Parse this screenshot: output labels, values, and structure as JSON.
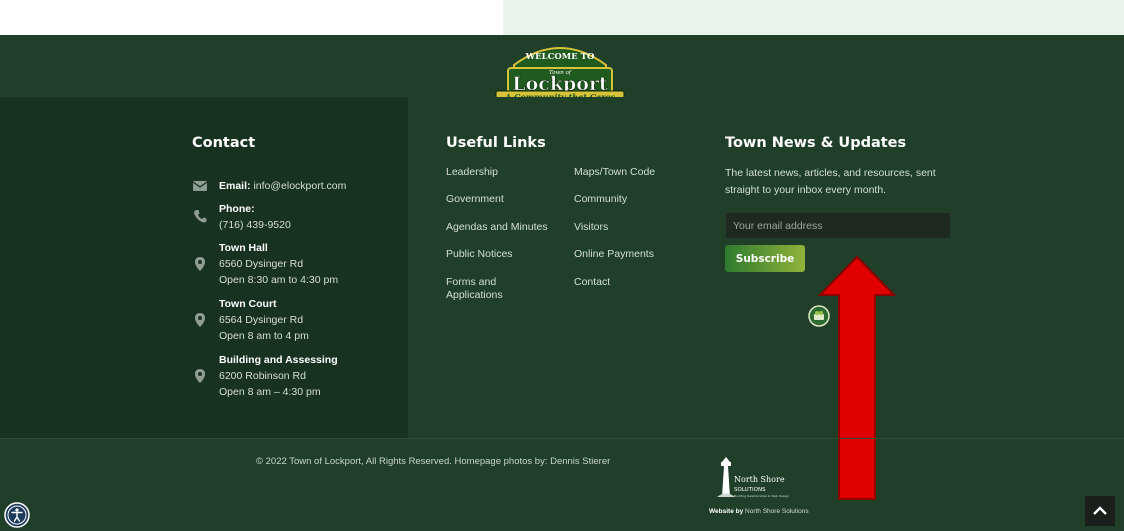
{
  "logo": {
    "welcome": "WELCOME TO",
    "town_of": "Town of",
    "name": "Lockport",
    "tagline": "A Community that Cares",
    "established": "ESTABLISHED 1824"
  },
  "contact": {
    "title": "Contact",
    "email_label": "Email:",
    "email_value": "info@elockport.com",
    "phone_label": "Phone:",
    "phone_value": "(716) 439-9520",
    "locations": [
      {
        "name": "Town Hall",
        "address": "6560 Dysinger Rd",
        "hours": "Open 8:30 am to 4:30 pm"
      },
      {
        "name": "Town Court",
        "address": "6564 Dysinger Rd",
        "hours": "Open 8 am to 4 pm"
      },
      {
        "name": "Building and Assessing",
        "address": "6200 Robinson Rd",
        "hours": "Open 8 am – 4:30 pm"
      }
    ]
  },
  "useful_links": {
    "title": "Useful Links",
    "col1": [
      "Leadership",
      "Government",
      "Agendas and Minutes",
      "Public Notices",
      "Forms and",
      "Applications"
    ],
    "col2": [
      "Maps/Town Code",
      "Community",
      "Visitors",
      "Online Payments",
      "Contact"
    ]
  },
  "news": {
    "title": "Town News & Updates",
    "description": "The latest news, articles, and resources, sent straight to your inbox every month.",
    "email_placeholder": "Your email address",
    "subscribe_label": "Subscribe"
  },
  "footer": {
    "copyright": "© 2022 Town of Lockport, All Rights Reserved. Homepage photos by: Dennis Stierer",
    "nss_name_1": "North Shore",
    "nss_name_2": "SOLUTIONS",
    "nss_tagline": "Building Relationships & Web Design",
    "credit_prefix": "Website by",
    "credit_name": "North Shore Solutions"
  },
  "icons": {
    "email": "envelope-icon",
    "phone": "phone-icon",
    "location": "map-pin-icon",
    "accessibility": "accessibility-icon",
    "back_to_top": "chevron-up-icon",
    "annotation": "red-arrow-up"
  },
  "colors": {
    "background": "#1f3f28",
    "left_panel": "#17331f",
    "accent_green": "#8fb33a",
    "arrow_red": "#e00000"
  }
}
